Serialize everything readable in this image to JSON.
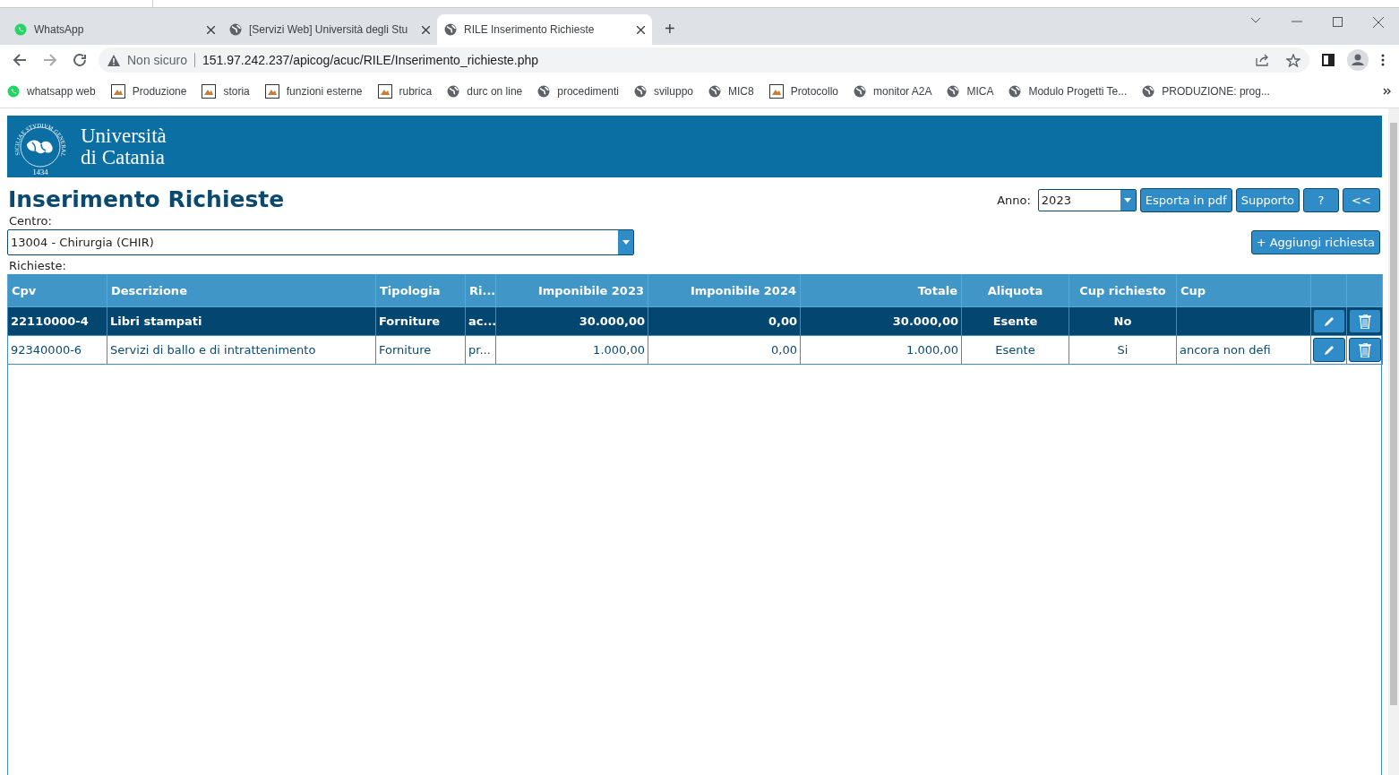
{
  "browser": {
    "tabs": [
      {
        "title": "WhatsApp",
        "kind": "whatsapp",
        "selected": false
      },
      {
        "title": "[Servizi Web] Università degli Stu",
        "kind": "globe",
        "selected": false
      },
      {
        "title": "RILE Inserimento Richieste",
        "kind": "globe",
        "selected": true
      }
    ],
    "new_tab": "+",
    "security": "Non sicuro",
    "url": "151.97.242.237/apicog/acuc/RILE/Inserimento_richieste.php",
    "bookmarks": [
      {
        "label": "whatsapp web",
        "kind": "whatsapp"
      },
      {
        "label": "Produzione",
        "kind": "image"
      },
      {
        "label": "storia",
        "kind": "image"
      },
      {
        "label": "funzioni esterne",
        "kind": "image"
      },
      {
        "label": "rubrica",
        "kind": "image"
      },
      {
        "label": "durc on line",
        "kind": "globe"
      },
      {
        "label": "procedimenti",
        "kind": "globe"
      },
      {
        "label": "sviluppo",
        "kind": "globe"
      },
      {
        "label": "MIC8",
        "kind": "globe"
      },
      {
        "label": "Protocollo",
        "kind": "image"
      },
      {
        "label": "monitor A2A",
        "kind": "globe"
      },
      {
        "label": "MICA",
        "kind": "globe"
      },
      {
        "label": "Modulo Progetti Te...",
        "kind": "globe"
      },
      {
        "label": "PRODUZIONE: prog...",
        "kind": "globe"
      }
    ]
  },
  "banner": {
    "seal_text": "SICILIAE STVDIVM GENERALE",
    "seal_year": "1434",
    "name_line_1": "Università",
    "name_line_2": "di Catania"
  },
  "page": {
    "title": "Inserimento Richieste",
    "anno_label": "Anno:",
    "anno_value": "2023",
    "buttons": [
      "Esporta in pdf",
      "Supporto",
      "?",
      "<<"
    ],
    "centro_label": "Centro:",
    "centro_value": "13004 - Chirurgia (CHIR)",
    "add_button": "+ Aggiungi richiesta",
    "richieste_label": "Richieste:"
  },
  "table": {
    "columns": [
      "Cpv",
      "Descrizione",
      "Tipologia",
      "Ri...",
      "Imponibile 2023",
      "Imponibile 2024",
      "Totale",
      "Aliquota",
      "Cup richiesto",
      "Cup"
    ],
    "rows": [
      {
        "cells": [
          "22110000-4",
          "Libri stampati",
          "Forniture",
          "ac...",
          "30.000,00",
          "0,00",
          "30.000,00",
          "Esente",
          "No",
          ""
        ],
        "selected": true
      },
      {
        "cells": [
          "92340000-6",
          "Servizi di ballo e di intrattenimento",
          "Forniture",
          "pr...",
          "1.000,00",
          "0,00",
          "1.000,00",
          "Esente",
          "Si",
          "ancora non defi"
        ],
        "selected": false
      }
    ]
  }
}
